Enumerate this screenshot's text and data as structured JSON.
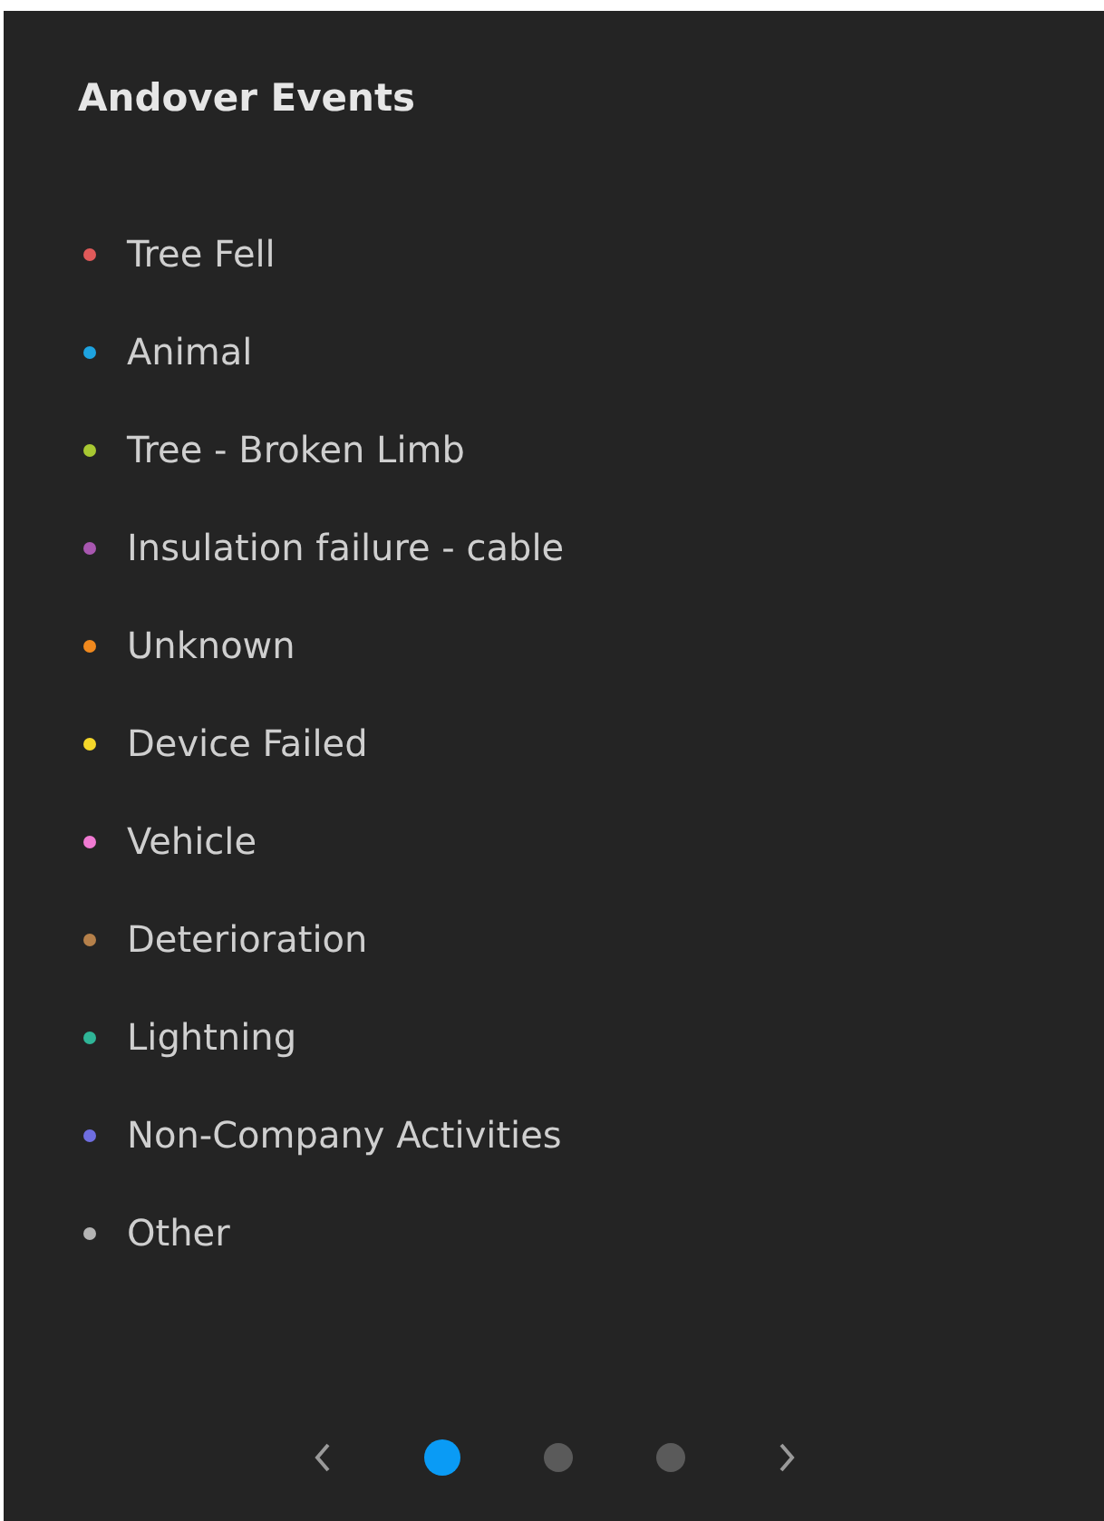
{
  "title": "Andover Events",
  "legend": [
    {
      "label": "Tree Fell",
      "color": "#e05a5a"
    },
    {
      "label": "Animal",
      "color": "#1ea3e0"
    },
    {
      "label": "Tree - Broken Limb",
      "color": "#a8c832"
    },
    {
      "label": "Insulation failure - cable",
      "color": "#a857b0"
    },
    {
      "label": "Unknown",
      "color": "#f0891e"
    },
    {
      "label": "Device Failed",
      "color": "#f5d72a"
    },
    {
      "label": "Vehicle",
      "color": "#f07ad2"
    },
    {
      "label": "Deterioration",
      "color": "#b5804a"
    },
    {
      "label": "Lightning",
      "color": "#2fb597"
    },
    {
      "label": "Non-Company Activities",
      "color": "#6f6ee0"
    },
    {
      "label": "Other",
      "color": "#b4b4b4"
    }
  ],
  "pager": [
    {
      "selected": true
    },
    {
      "selected": false
    },
    {
      "selected": false
    }
  ]
}
